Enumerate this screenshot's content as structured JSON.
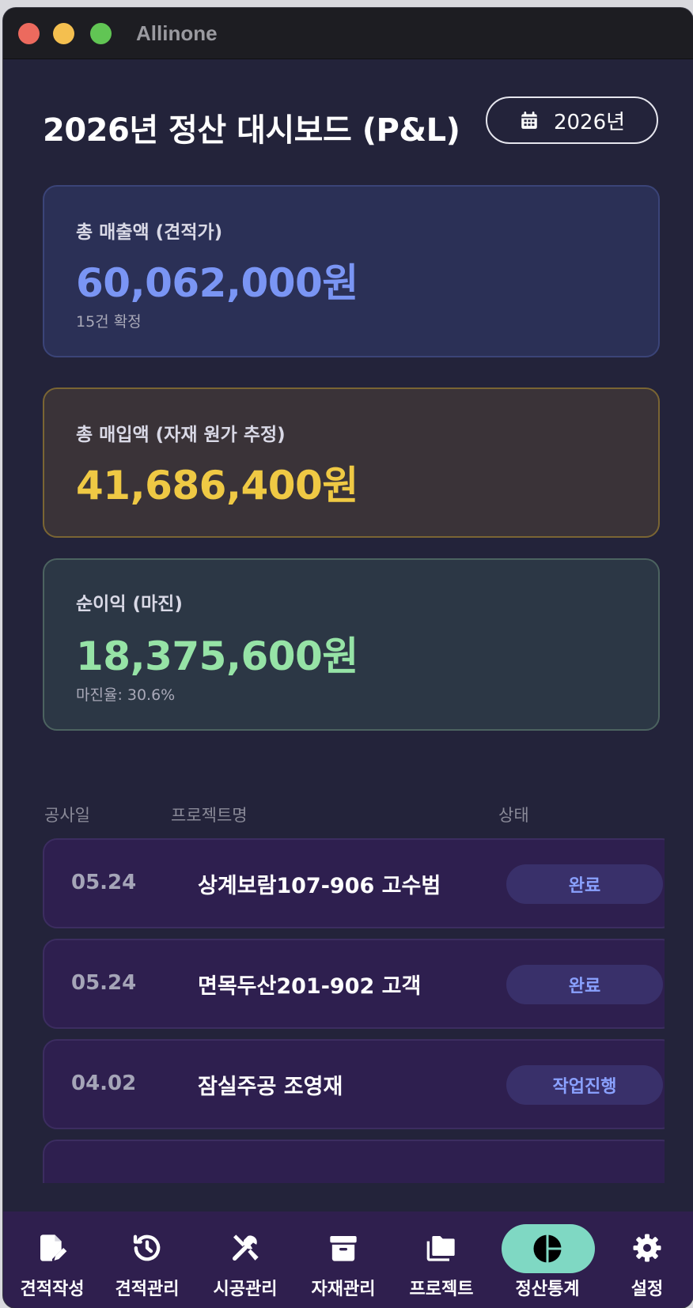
{
  "window": {
    "title": "Allinone"
  },
  "header": {
    "title": "2026년 정산 대시보드 (P&L)",
    "year_button": "2026년"
  },
  "cards": {
    "revenue": {
      "label": "총 매출액 (견적가)",
      "amount": "60,062,000원",
      "sub": "15건 확정",
      "color": "#7a95f4"
    },
    "cost": {
      "label": "총 매입액 (자재 원가 추정)",
      "amount": "41,686,400원",
      "color": "#efc944"
    },
    "profit": {
      "label": "순이익 (마진)",
      "amount": "18,375,600원",
      "sub": "마진율: 30.6%",
      "color": "#96e3a6"
    }
  },
  "table": {
    "headers": [
      "공사일",
      "프로젝트명",
      "상태"
    ],
    "rows": [
      {
        "date": "05.24",
        "name": "상계보람107-906 고수범",
        "status": "완료"
      },
      {
        "date": "05.24",
        "name": "면목두산201-902 고객",
        "status": "완료"
      },
      {
        "date": "04.02",
        "name": "잠실주공 조영재",
        "status": "작업진행"
      }
    ]
  },
  "nav": {
    "items": [
      {
        "label": "견적작성",
        "icon": "edit-document-icon"
      },
      {
        "label": "견적관리",
        "icon": "history-icon"
      },
      {
        "label": "시공관리",
        "icon": "tools-icon"
      },
      {
        "label": "자재관리",
        "icon": "archive-box-icon"
      },
      {
        "label": "프로젝트",
        "icon": "folders-icon"
      },
      {
        "label": "정산통계",
        "icon": "pie-chart-icon",
        "active": true
      },
      {
        "label": "설정",
        "icon": "gear-icon"
      }
    ]
  }
}
